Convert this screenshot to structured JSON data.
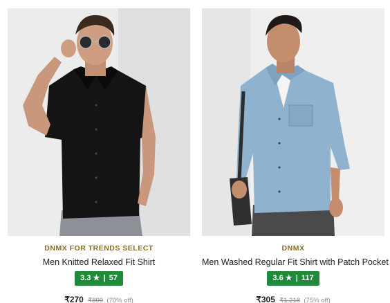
{
  "products": [
    {
      "brand": "DNMX FOR TRENDS SELECT",
      "title": "Men Knitted Relaxed Fit Shirt",
      "rating": "3.3",
      "star": "★",
      "reviews": "57",
      "price": "₹270",
      "mrp": "₹899",
      "discount": "(70% off)",
      "image": "model-black-knitted-shirt-sunglasses"
    },
    {
      "brand": "DNMX",
      "title": "Men Washed Regular Fit Shirt with Patch Pocket",
      "rating": "3.6",
      "star": "★",
      "reviews": "117",
      "price": "₹305",
      "mrp": "₹1,218",
      "discount": "(75% off)",
      "image": "model-light-blue-denim-shirt-bag"
    }
  ],
  "colors": {
    "brand": "#8a6d1f",
    "rating_badge": "#1f8a3a",
    "price": "#222222",
    "muted": "#8c8c8c"
  }
}
